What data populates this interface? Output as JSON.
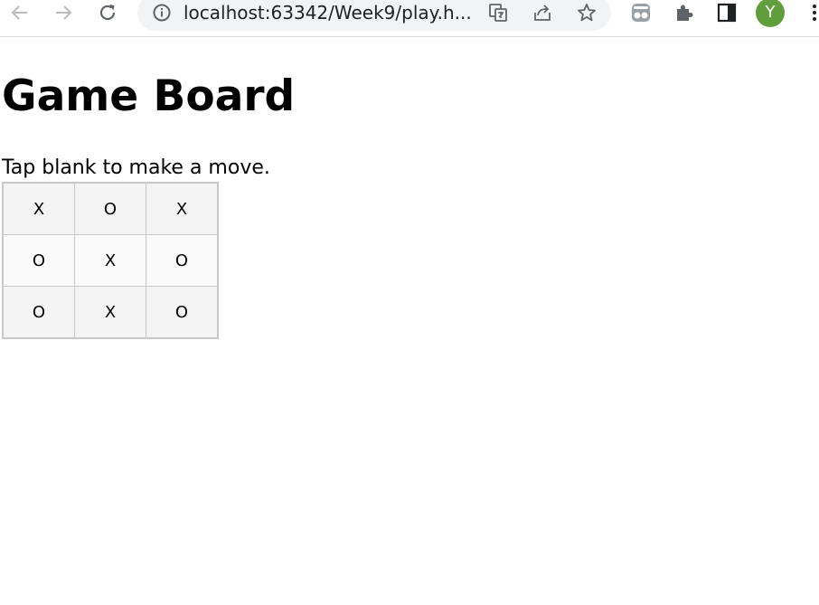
{
  "browser": {
    "url": "localhost:63342/Week9/play.h...",
    "profile_initial": "Y",
    "profile_color": "#5f9e3a",
    "icons": {
      "back": "arrow-left-icon",
      "forward": "arrow-right-icon",
      "reload": "reload-icon",
      "site_info": "info-icon",
      "translate": "translate-icon",
      "share": "share-icon",
      "bookmark": "star-icon",
      "extension_tampermonkey": "tampermonkey-icon",
      "extensions": "puzzle-icon",
      "side_panel": "side-panel-icon",
      "menu": "kebab-menu-icon"
    }
  },
  "page": {
    "title": "Game Board",
    "instructions": "Tap blank to make a move."
  },
  "board": {
    "rows": [
      [
        "X",
        "O",
        "X"
      ],
      [
        "O",
        "X",
        "O"
      ],
      [
        "O",
        "X",
        "O"
      ]
    ]
  }
}
